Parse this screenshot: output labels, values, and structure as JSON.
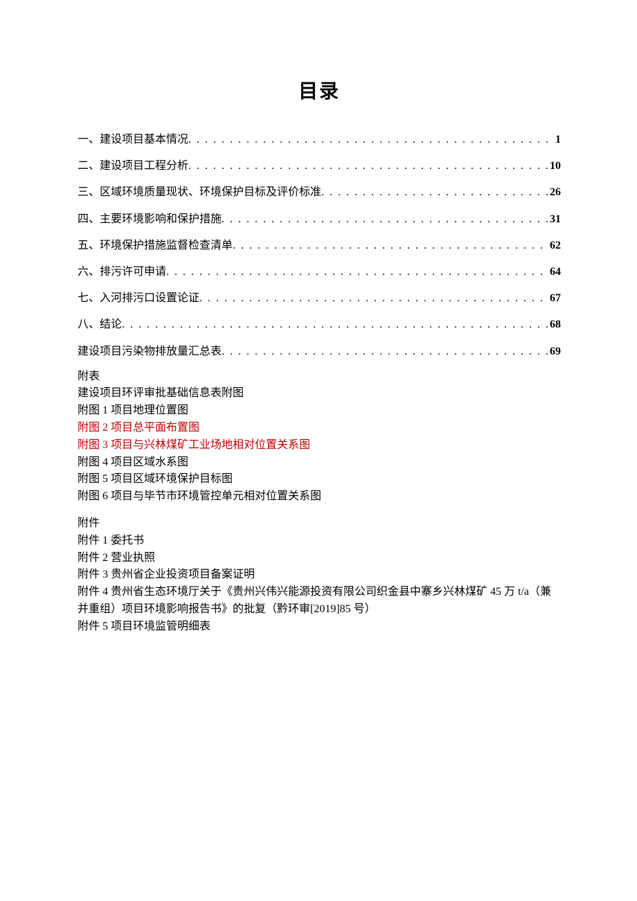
{
  "title": "目录",
  "toc": [
    {
      "label": "一、建设项目基本情况",
      "page": "1"
    },
    {
      "label": "二、建设项目工程分析",
      "page": "10"
    },
    {
      "label": "三、区域环境质量现状、环境保护目标及评价标准",
      "page": "26"
    },
    {
      "label": "四、主要环境影响和保护措施",
      "page": "31"
    },
    {
      "label": "五、环境保护措施监督检查清单",
      "page": "62"
    },
    {
      "label": "六、排污许可申请",
      "page": "64"
    },
    {
      "label": "七、入河排污口设置论证",
      "page": "67"
    },
    {
      "label": "八、结论",
      "page": "68"
    },
    {
      "label": "建设项目污染物排放量汇总表",
      "page": "69"
    }
  ],
  "appendix_tables_heading": "附表",
  "appendix_tables_line": "建设项目环评审批基础信息表附图",
  "figures": [
    {
      "text": "附图 1 项目地理位置图",
      "red": false
    },
    {
      "text": "附图 2 项目总平面布置图",
      "red": true
    },
    {
      "text": "附图 3 项目与兴林煤矿工业场地相对位置关系图",
      "red": true
    },
    {
      "text": "附图 4 项目区域水系图",
      "red": false
    },
    {
      "text": "附图 5 项目区域环境保护目标图",
      "red": false
    },
    {
      "text": "附图 6 项目与毕节市环境管控单元相对位置关系图",
      "red": false
    }
  ],
  "attachments_heading": "附件",
  "attachments": [
    "附件 1 委托书",
    "附件 2 营业执照",
    "附件 3 贵州省企业投资项目备案证明",
    "附件 4 贵州省生态环境厅关于《贵州兴伟兴能源投资有限公司织金县中寨乡兴林煤矿 45 万 t/a（兼并重组）项目环境影响报告书》的批复（黔环审[2019]85 号）",
    "附件 5 项目环境监管明细表"
  ]
}
